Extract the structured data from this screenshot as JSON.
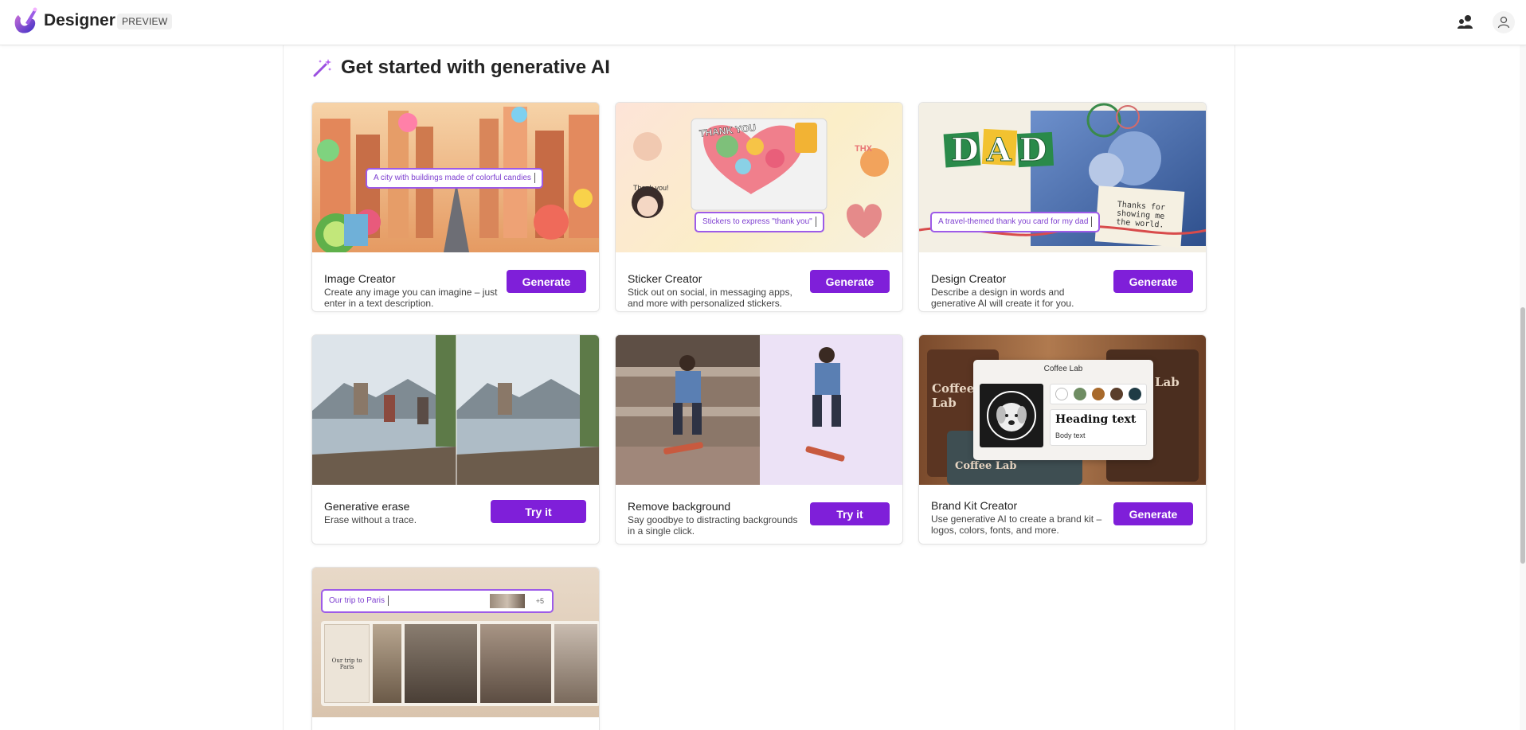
{
  "header": {
    "app_name": "Designer",
    "badge": "PREVIEW",
    "icons": [
      "designer-logo-icon",
      "share-people-icon",
      "account-icon"
    ]
  },
  "section": {
    "title": "Get started with generative AI",
    "icon": "magic-wand-icon"
  },
  "cards": [
    {
      "title": "Image Creator",
      "description": "Create any image you can imagine – just enter in a text description.",
      "button": "Generate",
      "prompt": "A city with buildings made of colorful candies"
    },
    {
      "title": "Sticker Creator",
      "description": "Stick out on social, in messaging apps, and more with personalized stickers.",
      "button": "Generate",
      "prompt": "Stickers to express \"thank you\"",
      "art_text": [
        "THANK YOU",
        "THANK YOU",
        "THX",
        "Thank you!",
        "Thank you"
      ]
    },
    {
      "title": "Design Creator",
      "description": "Describe a design in words and generative AI will create it for you.",
      "button": "Generate",
      "prompt": "A travel-themed thank you card for my dad",
      "art_text": [
        "DAD",
        "Thanks for showing me the world."
      ]
    },
    {
      "title": "Generative erase",
      "description": "Erase without a trace.",
      "button": "Try it"
    },
    {
      "title": "Remove background",
      "description": "Say goodbye to distracting backgrounds in a single click.",
      "button": "Try it"
    },
    {
      "title": "Brand Kit Creator",
      "description": "Use generative AI to create a brand kit – logos, colors, fonts, and more.",
      "button": "Generate",
      "brand_kit": {
        "name": "Coffee Lab",
        "heading_sample": "Heading text",
        "body_sample": "Body text",
        "bg_text_left": "Coffee Lab",
        "bg_text_right": "Lab",
        "bg_text_bottom": "Coffee Lab",
        "swatches": [
          "#ffffff",
          "#6f8d63",
          "#a86a2c",
          "#5a3e2b",
          "#1f3b45"
        ]
      }
    },
    {
      "prompt": "Our trip to Paris",
      "more_count": "+5",
      "art_text": "Our trip to Paris"
    }
  ],
  "colors": {
    "accent": "#7f1fd9",
    "prompt_border": "#9d5be8"
  }
}
